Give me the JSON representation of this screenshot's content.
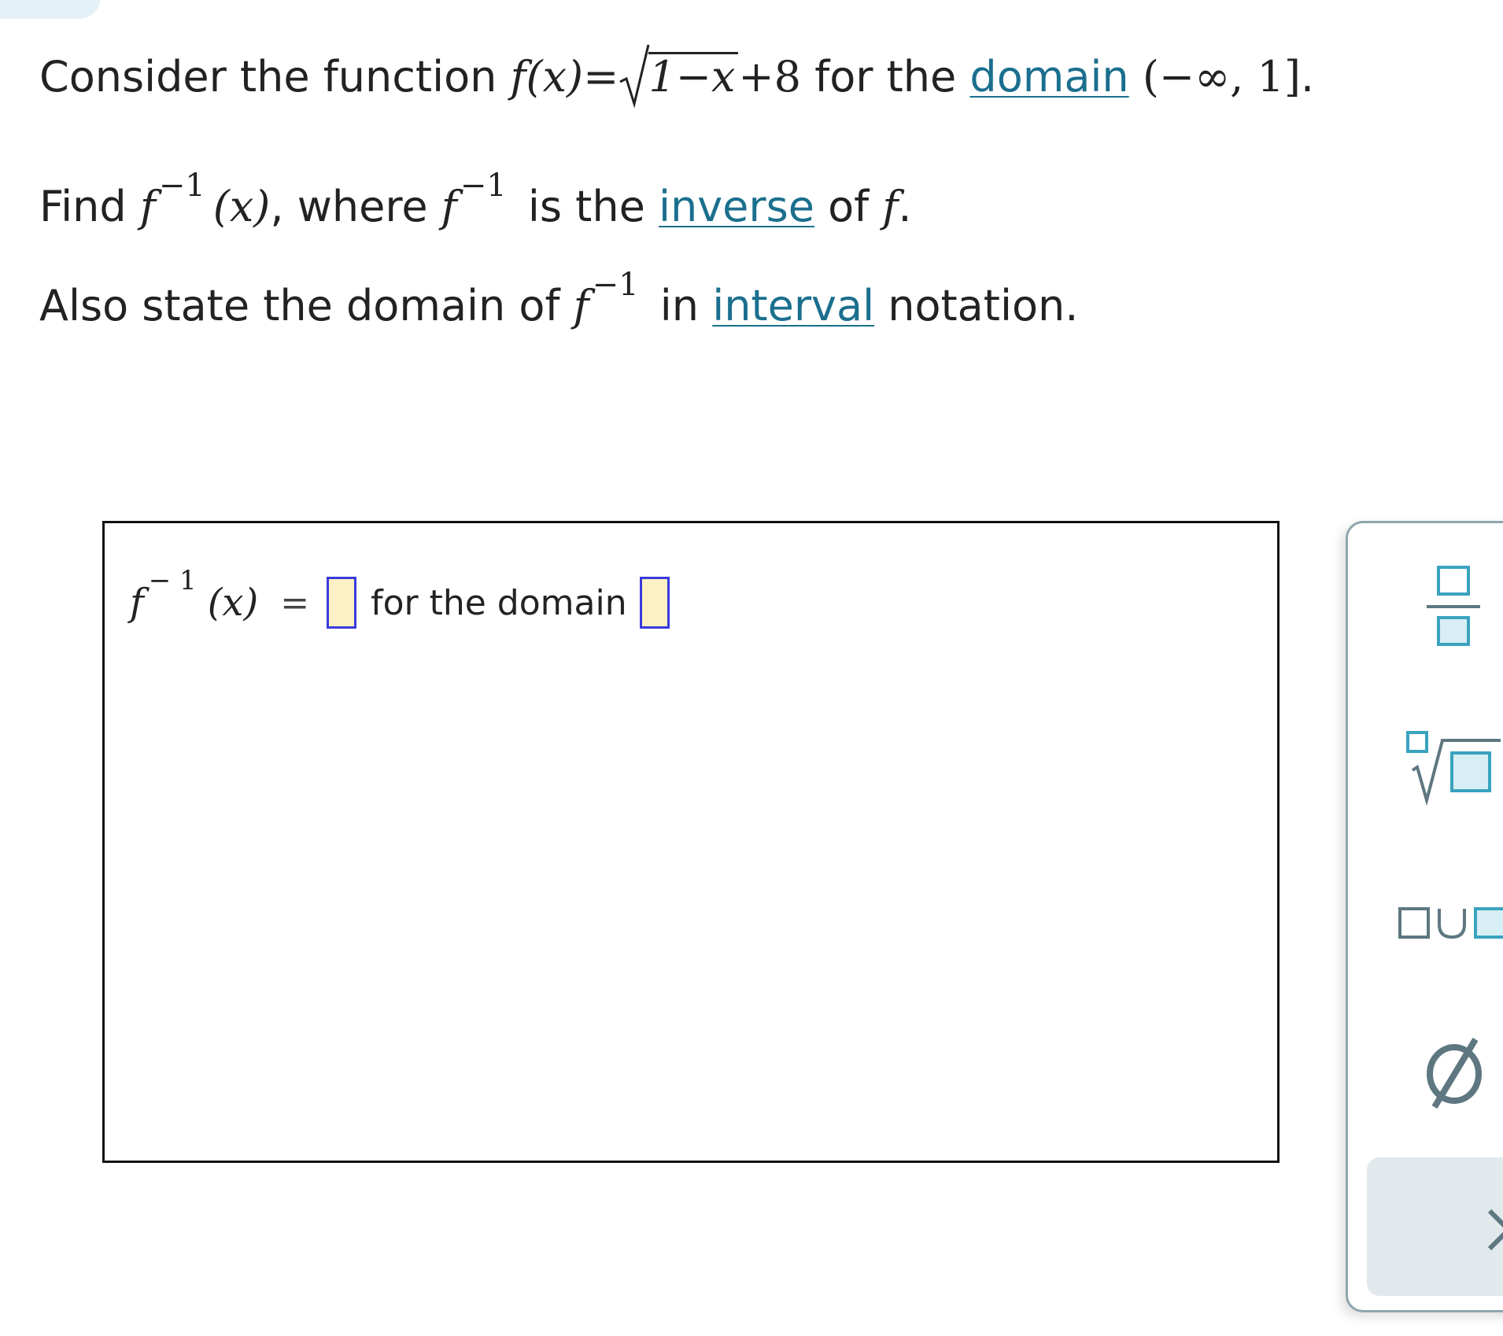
{
  "problem": {
    "line1": {
      "prefix": "Consider the function",
      "f": "f",
      "x_paren": "(x)",
      "equals": "=",
      "radicand": "1−x",
      "plus_term": "+8",
      "middle": "for the",
      "domain_link": "domain",
      "interval": "(−∞, 1]",
      "period": "."
    },
    "line2": {
      "prefix": "Find",
      "f": "f",
      "sup": "−1",
      "x_paren": "(x)",
      "comma_where": ", where",
      "f2": "f",
      "sup2": "−1",
      "is_the": "is the",
      "inverse_link": "inverse",
      "of": "of",
      "f3": "f",
      "period": "."
    },
    "line3": {
      "prefix": "Also state the domain of",
      "f": "f",
      "sup": "−1",
      "in": "in",
      "interval_link": "interval",
      "suffix": "notation."
    }
  },
  "answer": {
    "f": "f",
    "sup": "− 1",
    "x_paren": "(x)",
    "equals": "=",
    "domain_text": "for the domain"
  },
  "palette": {
    "buttons": [
      "fraction-button",
      "nth-root-button",
      "union-button",
      "empty-set-button"
    ],
    "empty_set_symbol": "∅"
  },
  "colors": {
    "link": "#1b6f8e",
    "slot_fill": "#fdf0c4",
    "slot_border": "#3a3adb",
    "icon_teal": "#3aa3be",
    "icon_gray": "#5e7780"
  }
}
